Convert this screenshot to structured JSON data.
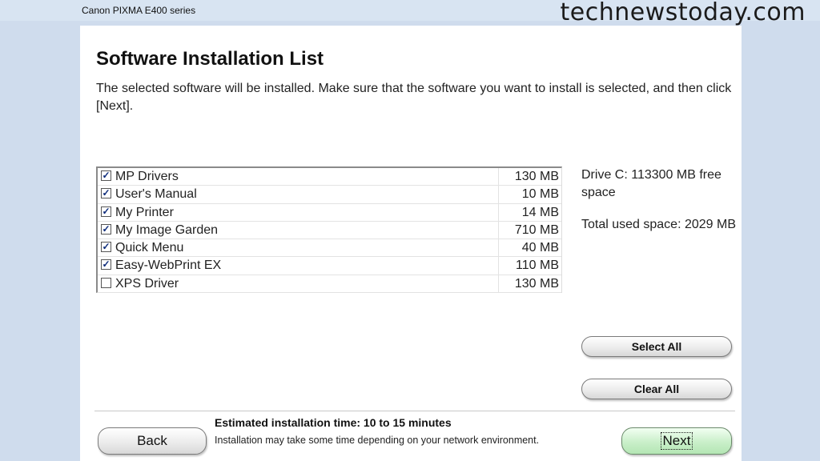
{
  "window": {
    "title": "Canon PIXMA E400 series"
  },
  "watermark": "technewstoday.com",
  "page": {
    "heading": "Software Installation List",
    "intro": "The selected software will be installed. Make sure that the software you want to install is selected, and then click [Next]."
  },
  "software_list": [
    {
      "name": "MP Drivers",
      "size": "130 MB",
      "checked": true
    },
    {
      "name": "User's Manual",
      "size": "10 MB",
      "checked": true
    },
    {
      "name": "My Printer",
      "size": "14 MB",
      "checked": true
    },
    {
      "name": "My Image Garden",
      "size": "710 MB",
      "checked": true
    },
    {
      "name": "Quick Menu",
      "size": "40 MB",
      "checked": true
    },
    {
      "name": "Easy-WebPrint EX",
      "size": "110 MB",
      "checked": true
    },
    {
      "name": "XPS Driver",
      "size": "130 MB",
      "checked": false
    }
  ],
  "disk": {
    "free_space": "Drive C: 113300 MB free space",
    "used_space": "Total used space: 2029 MB"
  },
  "buttons": {
    "select_all": "Select All",
    "clear_all": "Clear All",
    "back": "Back",
    "next": "Next"
  },
  "footer": {
    "estimate": "Estimated installation time: 10 to 15 minutes",
    "note": "Installation may take some time depending on your network environment."
  },
  "colors": {
    "window_bg": "#ffffff",
    "frame_bg": "#cfdced",
    "next_button": "#c9efc9"
  }
}
